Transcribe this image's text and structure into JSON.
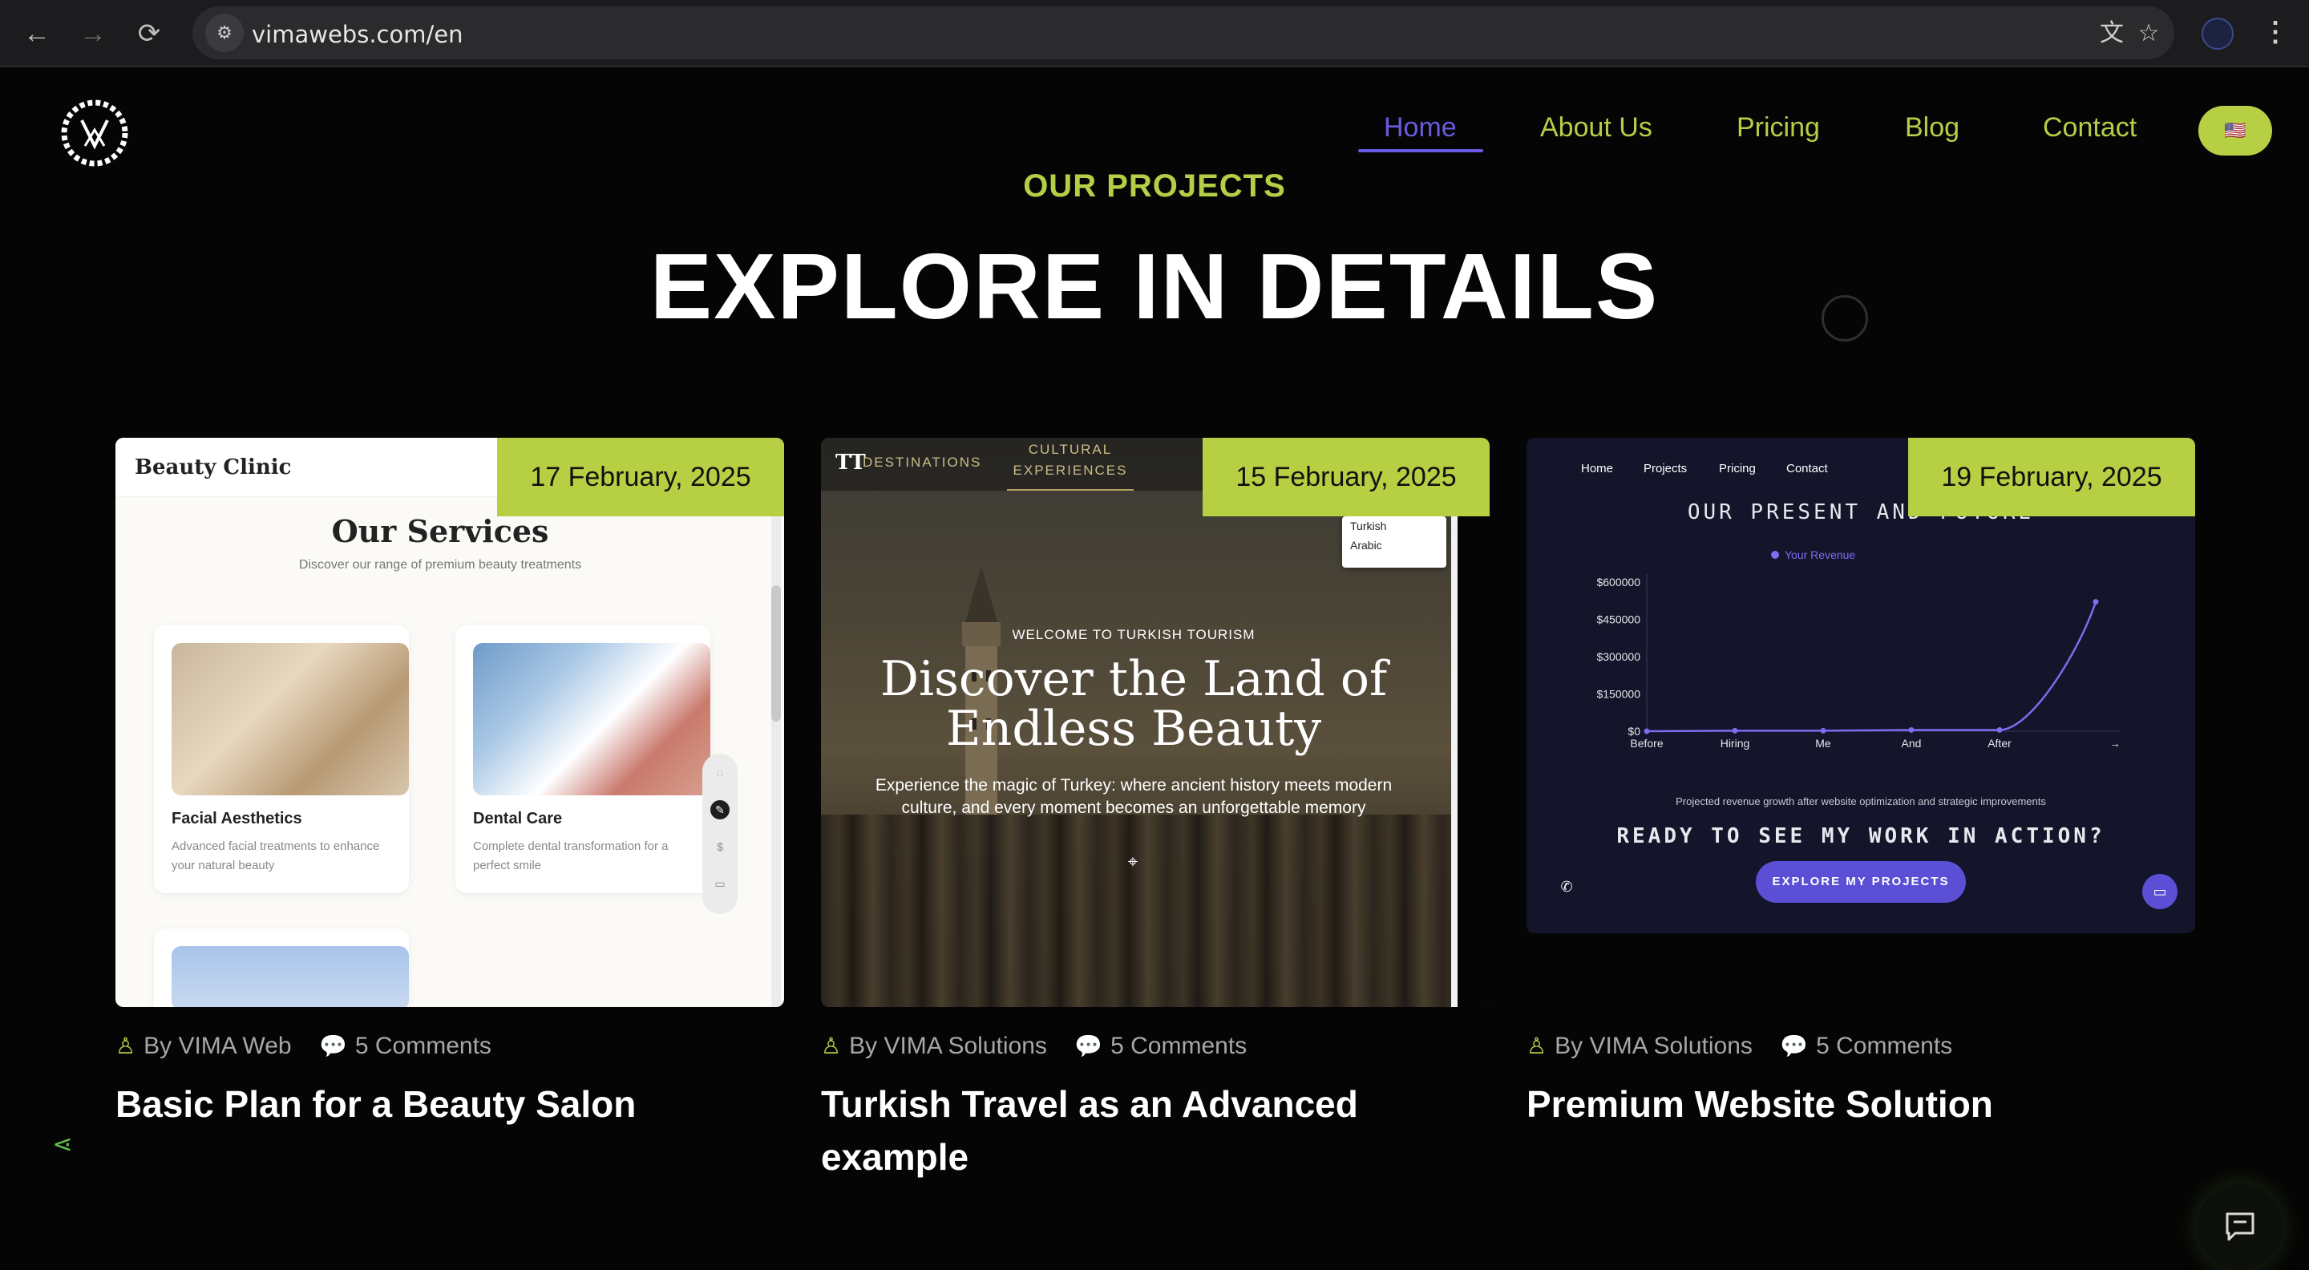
{
  "browser": {
    "url": "vimawebs.com/en"
  },
  "nav": {
    "items": [
      "Home",
      "About Us",
      "Pricing",
      "Blog",
      "Contact"
    ],
    "active": "Home",
    "language_flag": "🇺🇸"
  },
  "section": {
    "eyebrow": "OUR PROJECTS",
    "headline": "EXPLORE IN DETAILS"
  },
  "cards": [
    {
      "date": "17 February, 2025",
      "author": "By VIMA Web",
      "comments": "5 Comments",
      "title": "Basic Plan for a Beauty Salon",
      "preview": {
        "brand": "Beauty Clinic",
        "heading": "Our Services",
        "subheading": "Discover our range of premium beauty treatments",
        "services": [
          {
            "name": "Facial Aesthetics",
            "desc": "Advanced facial treatments to enhance your natural beauty"
          },
          {
            "name": "Dental Care",
            "desc": "Complete dental transformation for a perfect smile"
          }
        ]
      }
    },
    {
      "date": "15 February, 2025",
      "author": "By VIMA Solutions",
      "comments": "5 Comments",
      "title": "Turkish Travel as an Advanced example",
      "preview": {
        "logo": "TT",
        "nav": [
          "DESTINATIONS",
          "CULTURAL EXPERIENCES"
        ],
        "languages": [
          "Turkish",
          "Arabic"
        ],
        "kicker": "WELCOME TO TURKISH TOURISM",
        "hero": "Discover the Land of Endless Beauty",
        "body": "Experience the magic of Turkey: where ancient history meets modern culture, and every moment becomes an unforgettable memory"
      }
    },
    {
      "date": "19 February, 2025",
      "author": "By VIMA Solutions",
      "comments": "5 Comments",
      "title": "Premium Website Solution",
      "preview": {
        "nav": [
          "Home",
          "Projects",
          "Pricing",
          "Contact"
        ],
        "headline": "OUR PRESENT AND FUTURE",
        "legend": "Your Revenue",
        "caption": "Projected revenue growth after website optimization and strategic improvements",
        "cta": "READY TO SEE MY WORK IN ACTION?",
        "button": "EXPLORE MY PROJECTS"
      }
    }
  ],
  "chart_data": {
    "type": "line",
    "categories": [
      "Before",
      "Hiring",
      "Me",
      "And",
      "After"
    ],
    "series": [
      {
        "name": "Your Revenue",
        "values": [
          0,
          2000,
          2000,
          5000,
          5000,
          520000
        ]
      }
    ],
    "ytick_labels": [
      "$0",
      "$150000",
      "$300000",
      "$450000",
      "$600000"
    ],
    "ylim": [
      0,
      600000
    ],
    "colors": {
      "line": "#7b6ef0"
    }
  },
  "colors": {
    "accent": "#b4cf46",
    "active_nav": "#6a5ae0",
    "background": "#050505"
  }
}
